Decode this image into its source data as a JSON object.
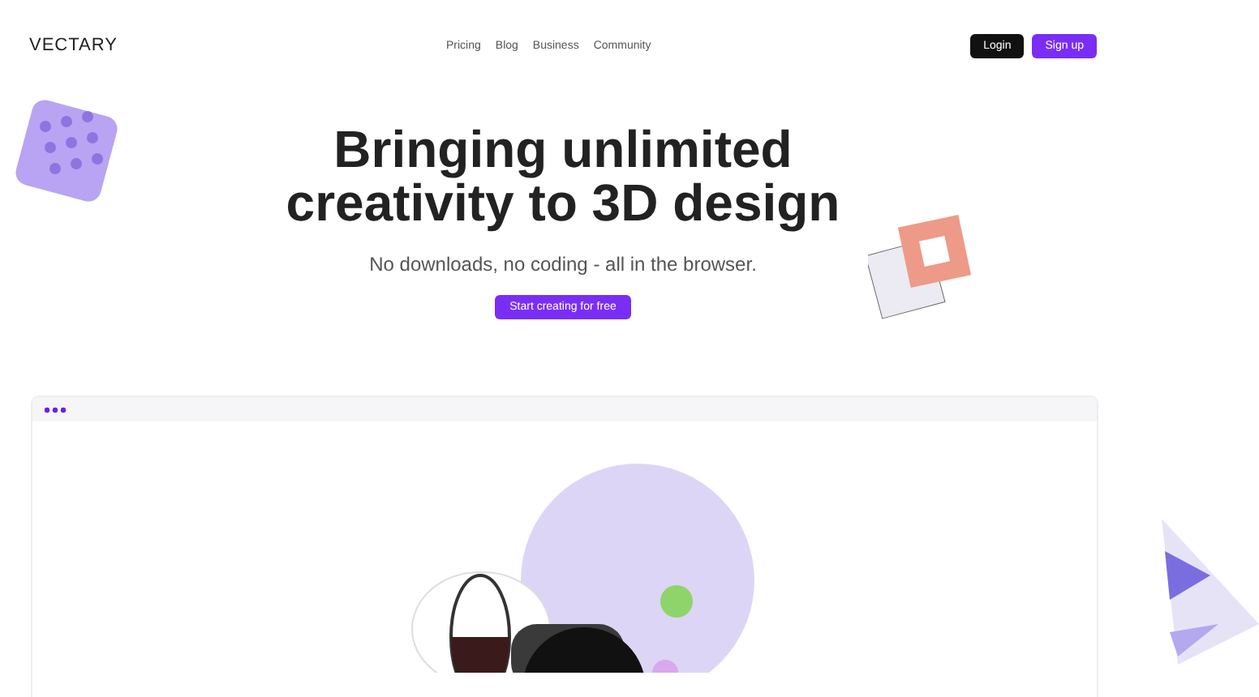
{
  "header": {
    "logo": "VECTARY",
    "nav": [
      "Pricing",
      "Blog",
      "Business",
      "Community"
    ],
    "login": "Login",
    "signup": "Sign up"
  },
  "hero": {
    "title_lines": [
      "Bringing unlimited",
      "creativity to 3D design"
    ],
    "subtitle": "No downloads, no coding - all in the browser.",
    "cta": "Start creating for free"
  }
}
